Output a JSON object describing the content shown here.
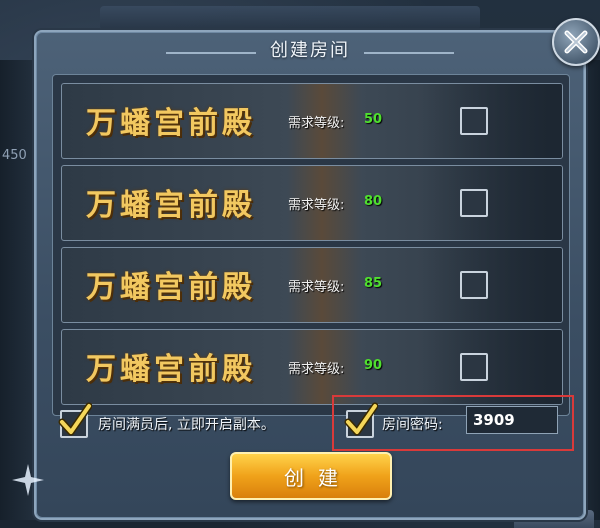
{
  "background": {
    "left_number": "450"
  },
  "dialog": {
    "title": "创建房间",
    "rows": [
      {
        "name": "万蟠宫前殿",
        "req_label": "需求等级:",
        "level": "50"
      },
      {
        "name": "万蟠宫前殿",
        "req_label": "需求等级:",
        "level": "80"
      },
      {
        "name": "万蟠宫前殿",
        "req_label": "需求等级:",
        "level": "85"
      },
      {
        "name": "万蟠宫前殿",
        "req_label": "需求等级:",
        "level": "90"
      }
    ],
    "auto_start_label": "房间满员后, 立即开启副本。",
    "password_label": "房间密码:",
    "password_value": "3909",
    "create_button": "创建"
  },
  "colors": {
    "level_green": "#4fe02e",
    "name_gold": "#f2c860",
    "highlight_red": "#d93a3a",
    "button_orange": "#f0a21a"
  }
}
